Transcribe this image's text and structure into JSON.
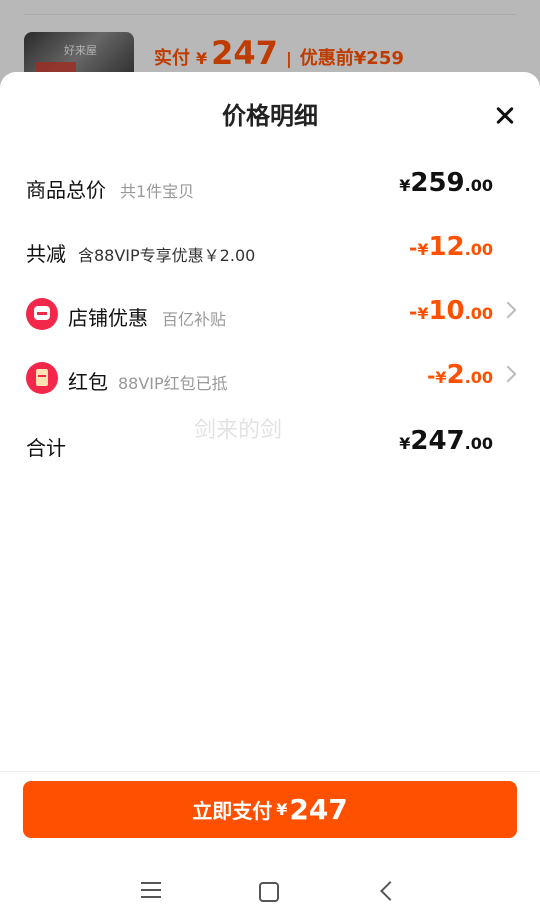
{
  "background": {
    "thumb_text": "好来屋",
    "price_label": "实付",
    "currency": "¥",
    "price_amount": "247",
    "separator": "|",
    "before_label": "优惠前¥259"
  },
  "sheet": {
    "title": "价格明细"
  },
  "rows": {
    "total": {
      "label": "商品总价",
      "sub": "共1件宝贝",
      "currency": "¥",
      "int": "259",
      "dec": ".00"
    },
    "discount": {
      "label": "共减",
      "sub": "含88VIP专享优惠￥2.00",
      "sign": "-",
      "currency": "¥",
      "int": "12",
      "dec": ".00"
    },
    "shop": {
      "label": "店铺优惠",
      "sub": "百亿补贴",
      "sign": "-",
      "currency": "¥",
      "int": "10",
      "dec": ".00"
    },
    "redpacket": {
      "label": "红包",
      "sub": "88VIP红包已抵",
      "sign": "-",
      "currency": "¥",
      "int": "2",
      "dec": ".00"
    },
    "sum": {
      "label": "合计",
      "currency": "¥",
      "int": "247",
      "dec": ".00"
    }
  },
  "watermark": "剑来的剑",
  "pay_button": {
    "label": "立即支付",
    "currency": "¥",
    "amount": "247"
  },
  "icons": {
    "close": "close-icon",
    "shop": "shop-icon",
    "redpacket": "red-packet-icon",
    "chevron": "chevron-right-icon",
    "nav_menu": "menu-icon",
    "nav_home": "home-icon",
    "nav_back": "back-icon"
  },
  "colors": {
    "accent": "#ff5000",
    "icon_red": "#f2274a"
  }
}
